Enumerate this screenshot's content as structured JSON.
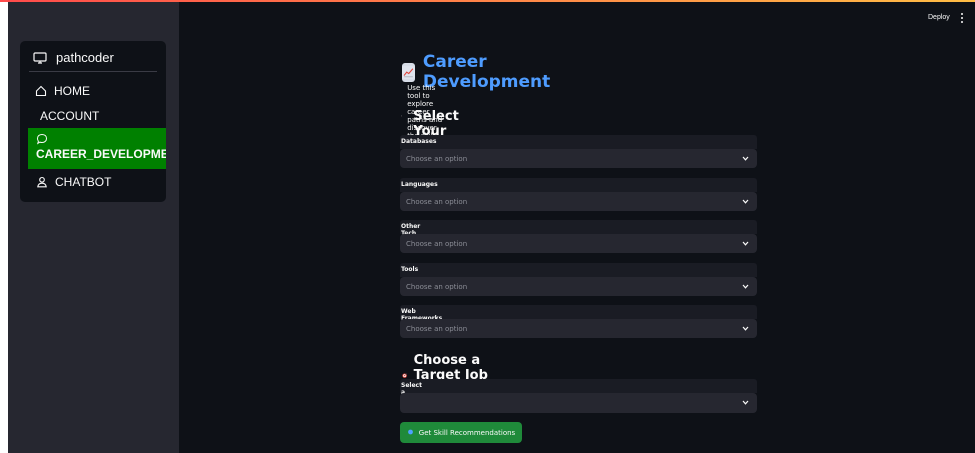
{
  "sidebar": {
    "app_name": "pathcoder",
    "items": [
      {
        "label": "HOME",
        "icon": "home-icon"
      },
      {
        "label": "ACCOUNT",
        "icon": ""
      },
      {
        "label": "CAREER_DEVELOPMEN",
        "icon": "chat-bubble-icon",
        "selected": true
      },
      {
        "label": "CHATBOT",
        "icon": "user-icon"
      }
    ]
  },
  "header": {
    "deploy_label": "Deploy",
    "menu_icon": "kebab-menu-icon"
  },
  "main": {
    "title": "Career Development",
    "title_icon": "chart-increasing-icon",
    "subtitle": "Use this tool to explore career paths and discover the skills you need.",
    "subtitle_icon": "rocket-icon",
    "skills_heading": "Select Your Existing Skills",
    "skills_icon": "hammer-wrench-icon",
    "skill_fields": [
      {
        "label": "Databases",
        "placeholder": "Choose an option"
      },
      {
        "label": "Languages",
        "placeholder": "Choose an option"
      },
      {
        "label": "Other Tech",
        "placeholder": "Choose an option"
      },
      {
        "label": "Tools",
        "placeholder": "Choose an option"
      },
      {
        "label": "Web Frameworks",
        "placeholder": "Choose an option"
      }
    ],
    "target_heading": "Choose a Target Job (Optional)",
    "target_icon": "target-icon",
    "career_goal_label": "Select a career goal",
    "career_goal_value": "",
    "button_label": "Get Skill Recommendations",
    "button_icon": "pin-icon"
  },
  "colors": {
    "background": "#0e1117",
    "sidebar": "#262730",
    "selected_nav": "#008000",
    "title_blue": "#4e9cff",
    "button_green": "#1f8a3a"
  }
}
